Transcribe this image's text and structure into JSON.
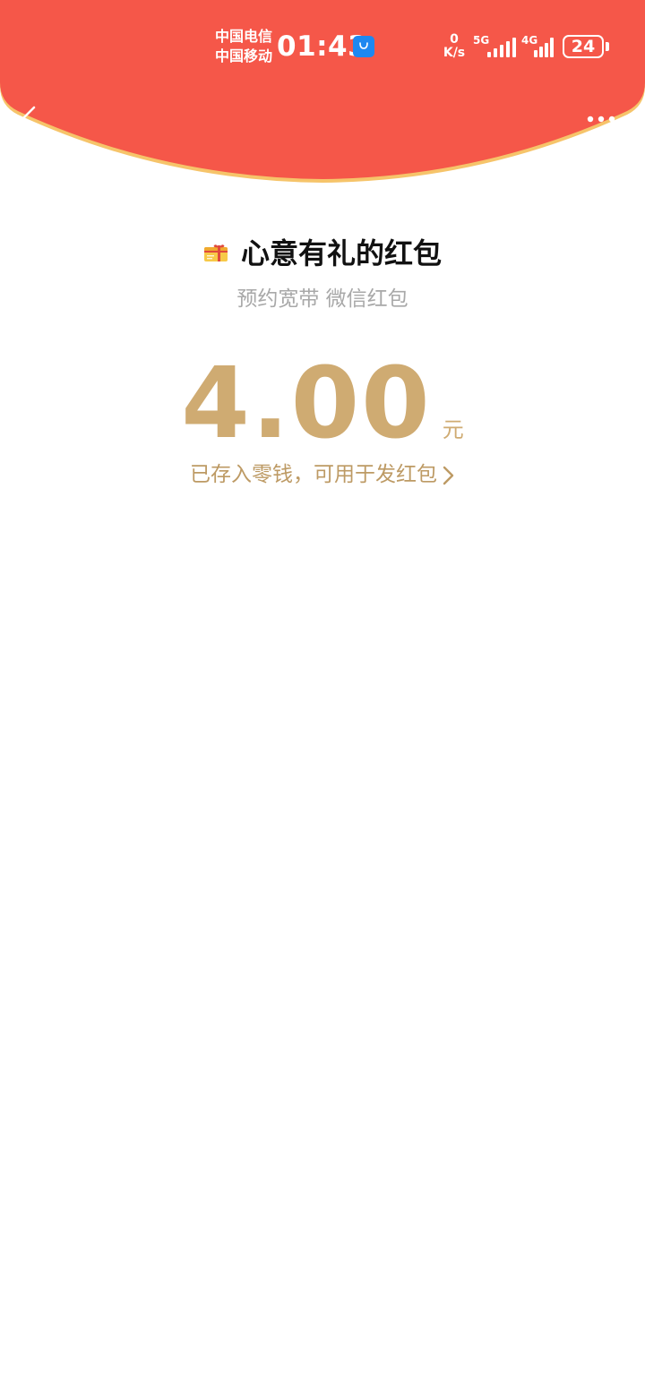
{
  "colors": {
    "header_red": "#f55749",
    "header_rim": "#f6c46a",
    "gold": "#cfab72",
    "gold_text": "#bd9a64",
    "app_icon_blue": "#1e88f0"
  },
  "status_bar": {
    "carrier_1": "中国电信",
    "carrier_2": "中国移动",
    "time": "01:43",
    "app_icon": "shopping-bag-icon",
    "net_speed_value": "0",
    "net_speed_unit": "K/s",
    "signal_1_label": "5G",
    "signal_2_label": "4G",
    "battery_percent": "24"
  },
  "nav": {
    "back_icon": "back-arrow-icon",
    "more_icon": "more-dots-icon"
  },
  "red_packet": {
    "title_icon": "gift-box-icon",
    "title": "心意有礼的红包",
    "subtitle": "预约宽带 微信红包",
    "amount": "4.00",
    "unit": "元",
    "wallet_note": "已存入零钱，可用于发红包",
    "wallet_chevron_icon": "chevron-right-icon"
  }
}
